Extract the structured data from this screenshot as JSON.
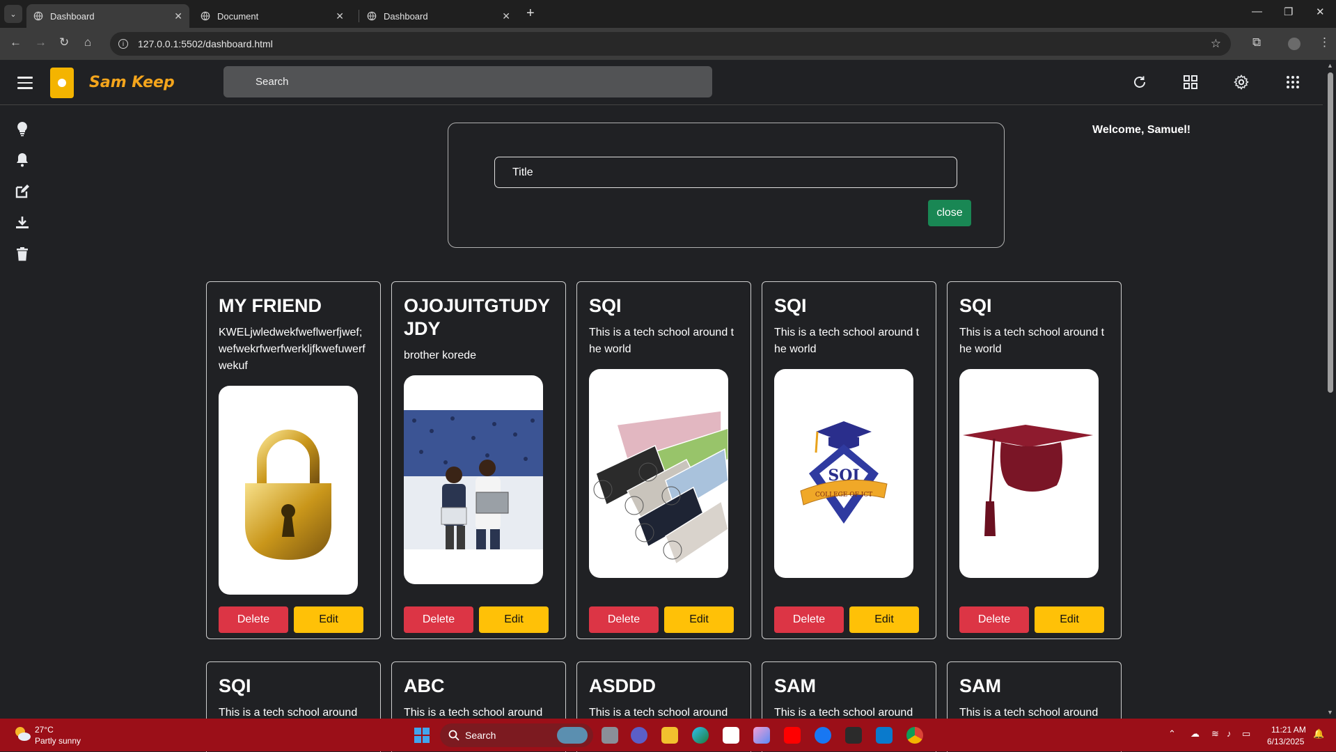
{
  "browser": {
    "tabs": [
      {
        "title": "Dashboard",
        "active": true
      },
      {
        "title": "Document",
        "active": false
      },
      {
        "title": "Dashboard",
        "active": false
      }
    ],
    "url": "127.0.0.1:5502/dashboard.html"
  },
  "app": {
    "name": "Sam Keep",
    "search_placeholder": "Search",
    "welcome": "Welcome, Samuel!",
    "form": {
      "title_placeholder": "Title",
      "close_label": "close"
    },
    "notes": [
      {
        "title": "MY FRIEND",
        "text": "KWELjwledwekfweflwerfjwef;wefwekrfwerfwerkljfkwefuwerfwekuf",
        "image": "padlock"
      },
      {
        "title": "OJOJUITGTUDYJDY",
        "text": "brother korede",
        "image": "photo of two students holding laptops"
      },
      {
        "title": "SQI",
        "text": "This is a tech school around the world",
        "image": "rolls of fabric"
      },
      {
        "title": "SQI",
        "text": "This is a tech school around the world",
        "image": "SQI College of ICT logo"
      },
      {
        "title": "SQI",
        "text": "This is a tech school around the world",
        "image": "graduation cap"
      }
    ],
    "notes_row2": [
      {
        "title": "SQI",
        "text": "This is a tech school around"
      },
      {
        "title": "ABC",
        "text": "This is a tech school around"
      },
      {
        "title": "ASDDD",
        "text": "This is a tech school around"
      },
      {
        "title": "SAM",
        "text": "This is a tech school around"
      },
      {
        "title": "SAM",
        "text": "This is a tech school around"
      }
    ],
    "buttons": {
      "delete": "Delete",
      "edit": "Edit"
    },
    "logo_text": "SQI",
    "logo_ribbon": "COLLEGE OF ICT"
  },
  "taskbar": {
    "weather_temp": "27°C",
    "weather_desc": "Partly sunny",
    "search_label": "Search",
    "time": "11:21 AM",
    "date": "6/13/2025"
  }
}
